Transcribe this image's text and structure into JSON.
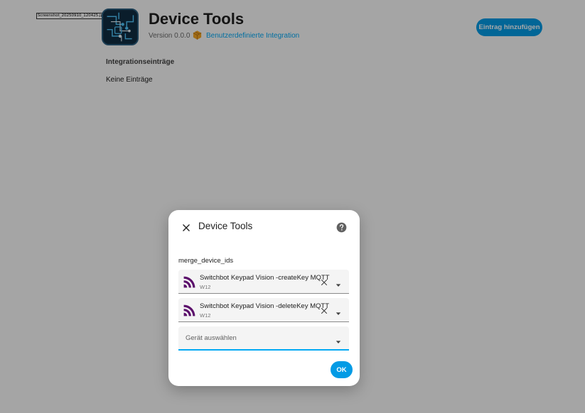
{
  "file_tag": "Screenshot_20250910_120425.jpg @ 50% (RGB/8)",
  "header": {
    "title": "Device Tools",
    "version": "Version 0.0.0",
    "custom_integration": "Benutzerdefinierte Integration",
    "add_entry_label": "Eintrag hinzufügen"
  },
  "entries": {
    "heading": "Integrationseinträge",
    "empty_text": "Keine Einträge"
  },
  "dialog": {
    "title": "Device Tools",
    "field_label": "merge_device_ids",
    "devices": [
      {
        "name": "Switchbot Keypad Vision -createKey MQTT",
        "area": "W12"
      },
      {
        "name": "Switchbot Keypad Vision -deleteKey MQTT",
        "area": "W12"
      }
    ],
    "select_placeholder": "Gerät auswählen",
    "ok_label": "OK"
  },
  "colors": {
    "accent": "#039be5",
    "link": "#03a9f4",
    "device_icon": "#5b0f6b",
    "package_icon": "#f5a623"
  },
  "icons": {
    "close": "close-icon",
    "help": "help-circle-icon",
    "device": "rss-feed-icon",
    "clear": "clear-icon",
    "dropdown": "menu-down-icon",
    "package": "package-icon"
  }
}
